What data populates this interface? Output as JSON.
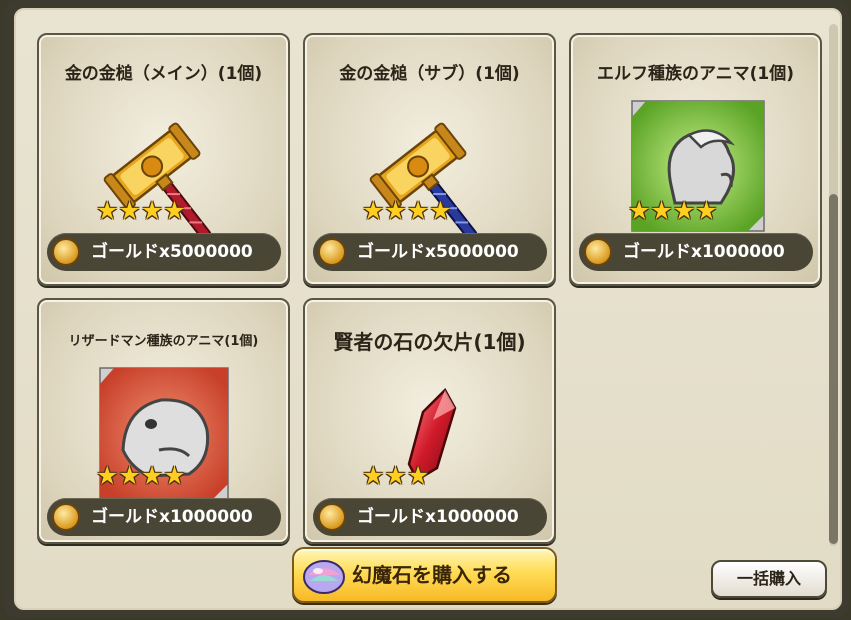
{
  "items": [
    {
      "title": "金の金槌（メイン）(1個)",
      "icon": "golden-hammer-red-handle-icon",
      "rarity": 4,
      "price": "ゴールドx5000000"
    },
    {
      "title": "金の金槌（サブ）(1個)",
      "icon": "golden-hammer-blue-handle-icon",
      "rarity": 4,
      "price": "ゴールドx5000000"
    },
    {
      "title": "エルフ種族のアニマ(1個)",
      "icon": "elf-anima-icon",
      "rarity": 4,
      "price": "ゴールドx1000000"
    },
    {
      "title": "リザードマン種族のアニマ(1個)",
      "icon": "lizardman-anima-icon",
      "rarity": 4,
      "price": "ゴールドx1000000"
    },
    {
      "title": "賢者の石の欠片(1個)",
      "icon": "philosophers-stone-fragment-icon",
      "rarity": 3,
      "price": "ゴールドx1000000"
    }
  ],
  "buttons": {
    "buy_gems": "幻魔石を購入する",
    "bulk_buy": "一括購入"
  },
  "colors": {
    "panel_bg": "#e9e4d2",
    "card_border": "#5b5544",
    "price_bar": "#4a4636",
    "star": "#ffcf1f",
    "gold_button": "#ffdc55",
    "elf_bg": "#7cc43a",
    "lizard_bg": "#d9573a"
  }
}
